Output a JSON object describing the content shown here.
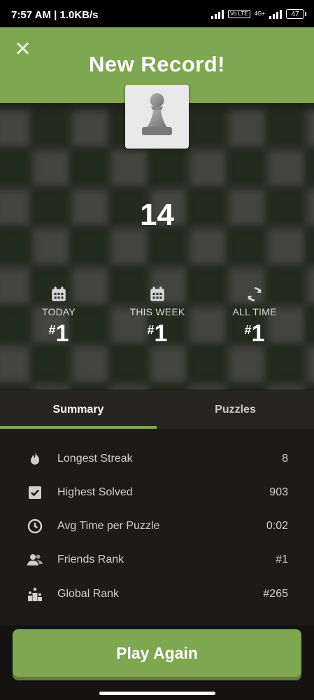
{
  "status_bar": {
    "time": "7:57 AM | 1.0KB/s",
    "volte": "Vo LTE",
    "network": "4G+",
    "battery": "47"
  },
  "header": {
    "title": "New Record!",
    "close_icon": "close-icon",
    "color": "#7fa650"
  },
  "score": "14",
  "ranks": [
    {
      "icon": "calendar-icon",
      "label": "TODAY",
      "hash": "#",
      "value": "1"
    },
    {
      "icon": "calendar-icon",
      "label": "THIS WEEK",
      "hash": "#",
      "value": "1"
    },
    {
      "icon": "refresh-icon",
      "label": "ALL TIME",
      "hash": "#",
      "value": "1"
    }
  ],
  "tabs": [
    {
      "label": "Summary",
      "active": true
    },
    {
      "label": "Puzzles",
      "active": false
    }
  ],
  "summary": [
    {
      "icon": "flame-icon",
      "label": "Longest Streak",
      "value": "8"
    },
    {
      "icon": "checkbox-icon",
      "label": "Highest Solved",
      "value": "903"
    },
    {
      "icon": "clock-icon",
      "label": "Avg Time per Puzzle",
      "value": "0:02"
    },
    {
      "icon": "friends-icon",
      "label": "Friends Rank",
      "value": "#1"
    },
    {
      "icon": "podium-icon",
      "label": "Global Rank",
      "value": "#265"
    }
  ],
  "play_again_label": "Play Again"
}
